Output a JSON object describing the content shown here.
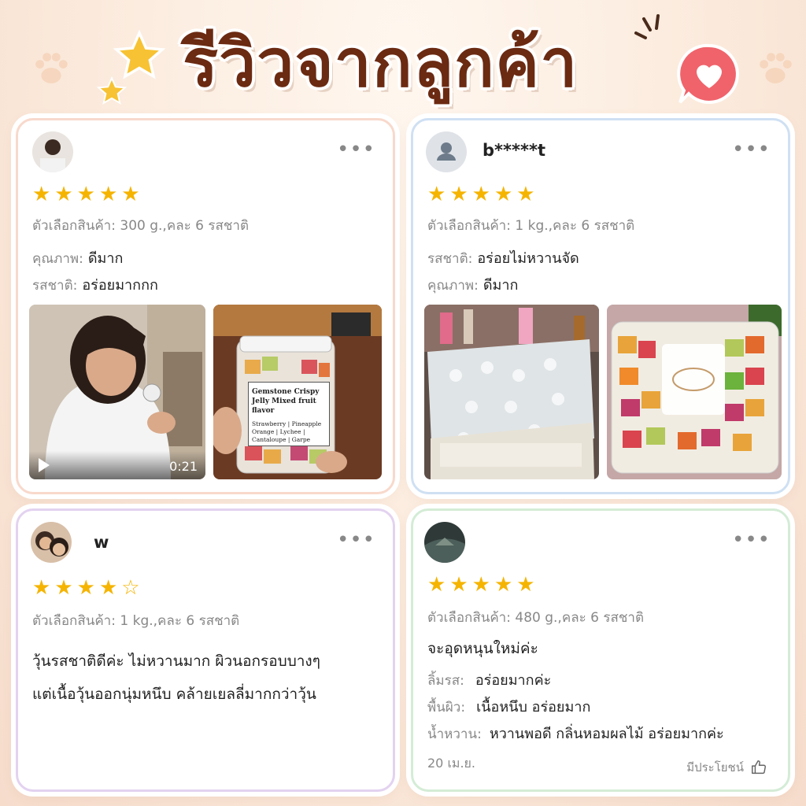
{
  "header": {
    "title": "รีวิวจากลูกค้า"
  },
  "colors": {
    "title": "#6b2a12",
    "star": "#f5b400",
    "heart_bubble": "#f0636b"
  },
  "reviews": [
    {
      "username": "",
      "rating": 5,
      "option_label": "ตัวเลือกสินค้า:",
      "option_value": "300 g.,คละ 6 รสชาติ",
      "details": [
        {
          "label": "คุณภาพ:",
          "value": "ดีมาก"
        },
        {
          "label": "รสชาติ:",
          "value": "อร่อยมากกก"
        }
      ],
      "video_duration": "0:21",
      "product_label": {
        "title": "Gemstone Crispy Jelly Mixed fruit flavor",
        "flavors": "Strawberry | Pineapple Orange | Lychee | Cantaloupe | Garpe"
      }
    },
    {
      "username": "b*****t",
      "rating": 5,
      "option_label": "ตัวเลือกสินค้า:",
      "option_value": "1 kg.,คละ 6 รสชาติ",
      "details": [
        {
          "label": "รสชาติ:",
          "value": "อร่อยไม่หวานจัด"
        },
        {
          "label": "คุณภาพ:",
          "value": "ดีมาก"
        }
      ]
    },
    {
      "username": "w",
      "rating": 4,
      "option_label": "ตัวเลือกสินค้า:",
      "option_value": "1 kg.,คละ 6 รสชาติ",
      "text_lines": [
        "วุ้นรสชาติดีค่ะ ไม่หวานมาก ผิวนอกรอบบางๆ",
        "แต่เนื้อวุ้นออกนุ่มหนึบ คล้ายเยลลี่มากกว่าวุ้น"
      ]
    },
    {
      "username": "",
      "rating": 5,
      "option_label": "ตัวเลือกสินค้า:",
      "option_value": "480 g.,คละ 6 รสชาติ",
      "headline": "จะอุดหนุนใหม่ค่ะ",
      "details": [
        {
          "label": "ลิ้มรส:",
          "value": "อร่อยมากค่ะ"
        },
        {
          "label": "พื้นผิว:",
          "value": "เนื้อหนึบ อร่อยมาก"
        },
        {
          "label": "น้ำหวาน:",
          "value": "หวานพอดี กลิ่นหอมผลไม้ อร่อยมากค่ะ"
        }
      ],
      "date": "20 เม.ย.",
      "helpful_label": "มีประโยชน์"
    }
  ],
  "icons": {
    "more": "more-dots-icon",
    "star": "star-icon",
    "play": "play-icon",
    "thumb": "thumbs-up-icon",
    "heart": "heart-bubble-icon",
    "paw": "paw-icon",
    "user": "default-user-icon"
  }
}
